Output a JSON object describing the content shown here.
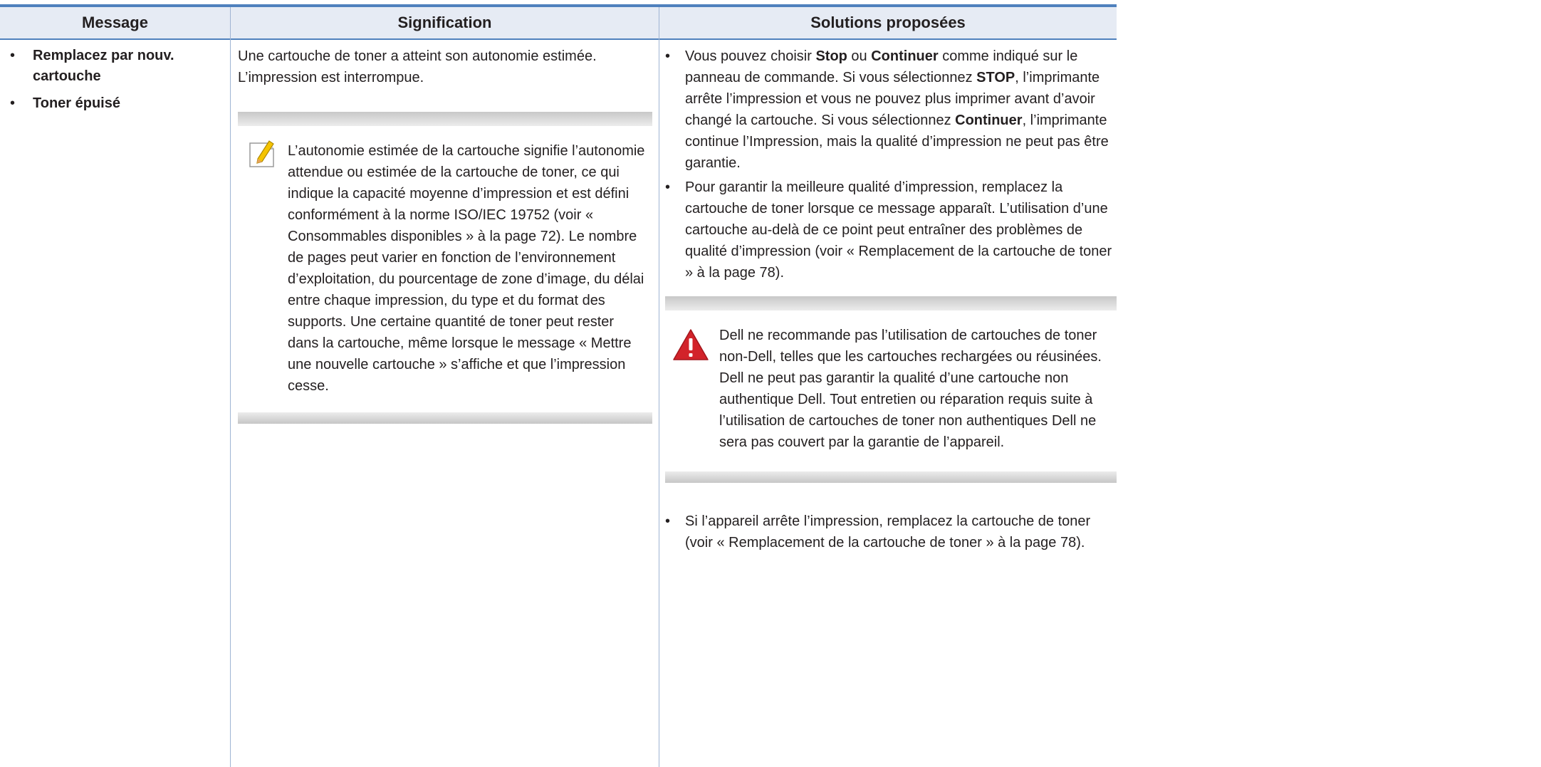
{
  "header": {
    "message": "Message",
    "signification": "Signification",
    "solutions": "Solutions proposées"
  },
  "messages": [
    "Remplacez par nouv. cartouche",
    "Toner épuisé"
  ],
  "signification": {
    "text": "Une cartouche de toner a atteint son autonomie estimée. L’impression est interrompue.",
    "note": "L’autonomie estimée de la cartouche signifie l’autonomie attendue ou estimée de la cartouche de toner, ce qui indique la capacité moyenne d’impression et est défini conformément à la norme ISO/IEC 19752 (voir « Consommables disponibles » à la page 72). Le nombre de pages peut varier en fonction de l’environnement d’exploitation, du pourcentage de zone d’image, du délai entre chaque impression, du type et du format des supports. Une certaine quantité de toner peut rester dans la cartouche, même lorsque le message « Mettre une nouvelle cartouche » s’affiche et que l’impression cesse."
  },
  "solutions": {
    "item1": {
      "a": "Vous pouvez choisir ",
      "b": "Stop",
      "c": " ou ",
      "d": "Continuer",
      "e": " comme indiqué sur le panneau de commande. Si vous sélectionnez ",
      "f": "STOP",
      "g": ", l’imprimante arrête l’impression et vous ne pouvez plus imprimer avant d’avoir changé la cartouche. Si vous sélectionnez ",
      "h": "Continuer",
      "i": ", l’imprimante continue l’Impression, mais la qualité d’impression ne peut pas être garantie."
    },
    "item2": "Pour garantir la meilleure qualité d’impression, remplacez la cartouche de toner lorsque ce message apparaît. L’utilisation d’une cartouche au-delà de ce point peut entraîner des problèmes de qualité d’impression (voir « Remplacement de la cartouche de toner » à la page 78).",
    "warning": "Dell ne recommande pas l’utilisation de cartouches de toner non-Dell, telles que les cartouches rechargées ou réusinées. Dell ne peut pas garantir la qualité d’une cartouche non authentique Dell. Tout entretien ou réparation requis suite à l’utilisation de cartouches de toner non authentiques Dell ne sera pas couvert par la garantie de l’appareil.",
    "item3": "Si l’appareil arrête l’impression, remplacez la cartouche de toner (voir « Remplacement de la cartouche de toner » à la page 78)."
  },
  "colors": {
    "header_bg": "#e6ebf4",
    "rule": "#4f81bd",
    "warning_red": "#d2232a",
    "note_yellow": "#f5c400"
  }
}
